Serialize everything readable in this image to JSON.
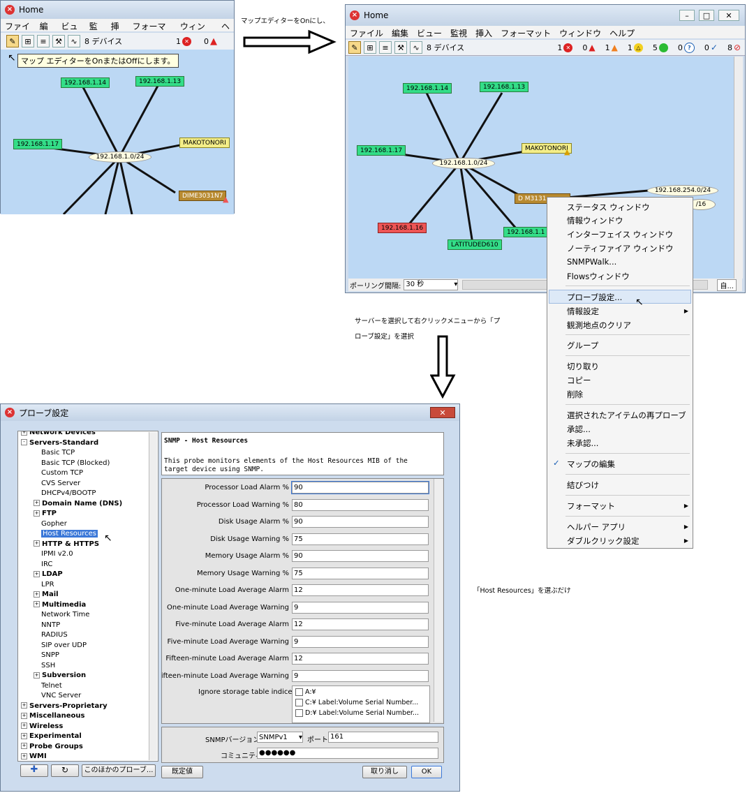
{
  "win1": {
    "title": "Home",
    "menu": [
      "ファイル",
      "編集",
      "ビュー",
      "監視",
      "挿入",
      "フォーマット",
      "ウィンドウ",
      "ヘ"
    ],
    "device_count": "8 デバイス",
    "count_red": "1",
    "count_warn": "0",
    "tooltip": "マップ エディターをOnまたはOffにします。",
    "nodes": {
      "n14": "192.168.1.14",
      "n13": "192.168.1.13",
      "n17": "192.168.1.17",
      "center": "192.168.1.0/24",
      "makoto": "MAKOTONORI",
      "dime": "DIME3031N7"
    }
  },
  "win2": {
    "title": "Home",
    "menu": [
      "ファイル",
      "編集",
      "ビュー",
      "監視",
      "挿入",
      "フォーマット",
      "ウィンドウ",
      "ヘルプ"
    ],
    "device_count": "8 デバイス",
    "counts": [
      "1",
      "0",
      "1",
      "1",
      "5",
      "0",
      "0",
      "8"
    ],
    "nodes": {
      "n14": "192.168.1.14",
      "n13": "192.168.1.13",
      "n17": "192.168.1.17",
      "center": "192.168.1.0/24",
      "makoto": "MAKOTONORI",
      "dime": "D M3131",
      "net254": "192.168.254.0/24",
      "net16": "/16",
      "n16": "192.168.1.16",
      "n1": "192.168.1.1",
      "lat": "LATITUDED610"
    },
    "polling_label": "ポーリング間隔:",
    "polling_value": "30 秒",
    "bottom_right": "自..."
  },
  "annotations": {
    "arrow1_text": "マップエディターをOnにし、",
    "step2_line1": "サーバーを選択して右クリックメニューから「プ",
    "step2_line2": "ローブ設定」を選択",
    "step3": "「Host Resources」を選ぶだけ"
  },
  "context_menu": [
    {
      "label": "ステータス ウィンドウ",
      "sub": false
    },
    {
      "label": "情報ウィンドウ",
      "sub": false
    },
    {
      "label": "インターフェイス ウィンドウ",
      "sub": false
    },
    {
      "label": "ノーティファイア ウィンドウ",
      "sub": false
    },
    {
      "label": "SNMPWalk...",
      "sub": false
    },
    {
      "label": "Flowsウィンドウ",
      "sub": false
    },
    {
      "label": "プローブ設定...",
      "sub": false
    },
    {
      "label": "情報設定",
      "sub": true
    },
    {
      "label": "観測地点のクリア",
      "sub": false
    },
    {
      "label": "グループ",
      "sub": false
    },
    {
      "label": "切り取り",
      "sub": false
    },
    {
      "label": "コピー",
      "sub": false
    },
    {
      "label": "削除",
      "sub": false
    },
    {
      "label": "選択されたアイテムの再プローブ",
      "sub": false
    },
    {
      "label": "承認...",
      "sub": false
    },
    {
      "label": "未承認...",
      "sub": false
    },
    {
      "label": "マップの編集",
      "sub": false,
      "checked": true
    },
    {
      "label": "結びつけ",
      "sub": false
    },
    {
      "label": "フォーマット",
      "sub": true
    },
    {
      "label": "ヘルパー アプリ",
      "sub": true
    },
    {
      "label": "ダブルクリック設定",
      "sub": true
    }
  ],
  "dialog": {
    "title": "プローブ設定",
    "tree": [
      {
        "label": "Network Devices",
        "bold": true,
        "exp": "+"
      },
      {
        "label": "Servers-Standard",
        "bold": true,
        "exp": "-"
      },
      {
        "label": "Basic TCP",
        "bold": false,
        "exp": ""
      },
      {
        "label": "Basic TCP (Blocked)",
        "bold": false,
        "exp": ""
      },
      {
        "label": "Custom TCP",
        "bold": false,
        "exp": ""
      },
      {
        "label": "CVS Server",
        "bold": false,
        "exp": ""
      },
      {
        "label": "DHCPv4/BOOTP",
        "bold": false,
        "exp": ""
      },
      {
        "label": "Domain Name (DNS)",
        "bold": true,
        "exp": "+"
      },
      {
        "label": "FTP",
        "bold": true,
        "exp": "+"
      },
      {
        "label": "Gopher",
        "bold": false,
        "exp": ""
      },
      {
        "label": "Host Resources",
        "bold": false,
        "exp": "",
        "selected": true
      },
      {
        "label": "HTTP & HTTPS",
        "bold": true,
        "exp": "+"
      },
      {
        "label": "IPMI v2.0",
        "bold": false,
        "exp": ""
      },
      {
        "label": "IRC",
        "bold": false,
        "exp": ""
      },
      {
        "label": "LDAP",
        "bold": true,
        "exp": "+"
      },
      {
        "label": "LPR",
        "bold": false,
        "exp": ""
      },
      {
        "label": "Mail",
        "bold": true,
        "exp": "+"
      },
      {
        "label": "Multimedia",
        "bold": true,
        "exp": "+"
      },
      {
        "label": "Network Time",
        "bold": false,
        "exp": ""
      },
      {
        "label": "NNTP",
        "bold": false,
        "exp": ""
      },
      {
        "label": "RADIUS",
        "bold": false,
        "exp": ""
      },
      {
        "label": "SIP over UDP",
        "bold": false,
        "exp": ""
      },
      {
        "label": "SNPP",
        "bold": false,
        "exp": ""
      },
      {
        "label": "SSH",
        "bold": false,
        "exp": ""
      },
      {
        "label": "Subversion",
        "bold": true,
        "exp": "+"
      },
      {
        "label": "Telnet",
        "bold": false,
        "exp": ""
      },
      {
        "label": "VNC Server",
        "bold": false,
        "exp": ""
      },
      {
        "label": "Servers-Proprietary",
        "bold": true,
        "exp": "+",
        "root": true
      },
      {
        "label": "Miscellaneous",
        "bold": true,
        "exp": "+",
        "root": true
      },
      {
        "label": "Wireless",
        "bold": true,
        "exp": "+",
        "root": true
      },
      {
        "label": "Experimental",
        "bold": true,
        "exp": "+",
        "root": true
      },
      {
        "label": "Probe Groups",
        "bold": true,
        "exp": "+",
        "root": true
      },
      {
        "label": "WMI",
        "bold": true,
        "exp": "+",
        "root": true
      }
    ],
    "desc_title": "SNMP - Host Resources",
    "desc_body": "This probe monitors elements of the Host Resources MIB of the target device using SNMP.",
    "params": [
      {
        "label": "Processor Load Alarm %",
        "value": "90"
      },
      {
        "label": "Processor Load Warning %",
        "value": "80"
      },
      {
        "label": "Disk Usage Alarm %",
        "value": "90"
      },
      {
        "label": "Disk Usage Warning %",
        "value": "75"
      },
      {
        "label": "Memory Usage Alarm %",
        "value": "90"
      },
      {
        "label": "Memory Usage Warning %",
        "value": "75"
      },
      {
        "label": "One-minute Load Average Alarm",
        "value": "12"
      },
      {
        "label": "One-minute Load Average Warning",
        "value": "9"
      },
      {
        "label": "Five-minute Load Average Alarm",
        "value": "12"
      },
      {
        "label": "Five-minute Load Average Warning",
        "value": "9"
      },
      {
        "label": "Fifteen-minute Load Average Alarm",
        "value": "12"
      },
      {
        "label": "Fifteen-minute Load Average Warning",
        "value": "9"
      }
    ],
    "ignore_label": "Ignore storage table indices:",
    "storage": [
      "A:¥",
      "C:¥ Label:Volume  Serial Number...",
      "D:¥ Label:Volume  Serial Number..."
    ],
    "snmp_version_label": "SNMPバージョン:",
    "snmp_version": "SNMPv1",
    "port_label": "ポート:",
    "port": "161",
    "community_label": "コミュニティ:",
    "community": "●●●●●●",
    "btn_other": "このほかのプローブ...",
    "btn_default": "既定値",
    "btn_cancel": "取り消し",
    "btn_ok": "OK"
  }
}
